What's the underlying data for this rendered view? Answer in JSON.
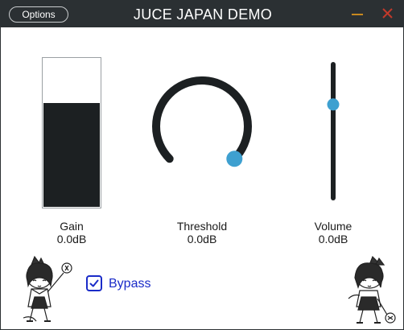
{
  "window": {
    "title": "JUCE JAPAN DEMO",
    "options_label": "Options",
    "minimize_icon": "minimize-icon",
    "close_icon": "close-icon"
  },
  "colors": {
    "titlebar_bg": "#2b3033",
    "accent": "#3ea0d0",
    "dark": "#1c2022",
    "bypass_blue": "#1a2bc8",
    "minimize_color": "#c8891f",
    "close_color": "#c0392b"
  },
  "controls": {
    "gain": {
      "label": "Gain",
      "value": "0.0dB",
      "level_fraction": 0.7
    },
    "threshold": {
      "label": "Threshold",
      "value": "0.0dB",
      "knob_fraction": 1.0
    },
    "volume": {
      "label": "Volume",
      "value": "0.0dB",
      "slider_fraction": 0.7
    }
  },
  "bypass": {
    "label": "Bypass",
    "checked": true
  }
}
